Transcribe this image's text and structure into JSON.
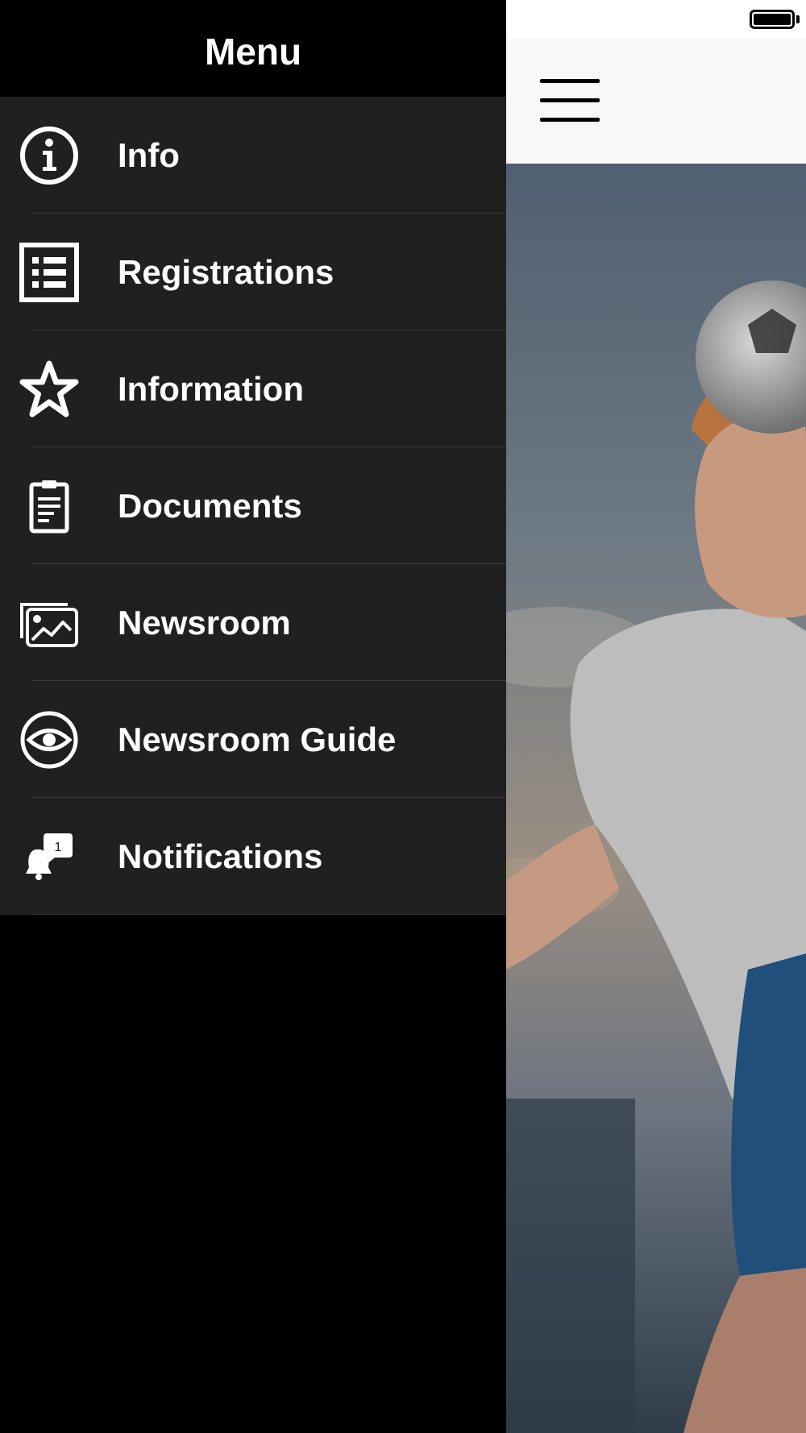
{
  "drawer": {
    "title": "Menu",
    "background": "#000000",
    "list_background": "#202020",
    "items": [
      {
        "label": "Info",
        "icon": "info-icon"
      },
      {
        "label": "Registrations",
        "icon": "list-icon"
      },
      {
        "label": "Information",
        "icon": "star-icon"
      },
      {
        "label": "Documents",
        "icon": "clipboard-icon"
      },
      {
        "label": "Newsroom",
        "icon": "gallery-icon"
      },
      {
        "label": "Newsroom Guide",
        "icon": "eye-icon"
      },
      {
        "label": "Notifications",
        "icon": "bell-badge-icon",
        "badge": "1"
      }
    ]
  },
  "status_bar": {
    "battery_level": 1.0,
    "battery_icon": "battery-icon"
  },
  "app_header": {
    "menu_icon": "hamburger-icon",
    "background": "#f8f8f8"
  },
  "hero": {
    "image": "soccer-player-heading-ball-photo"
  }
}
